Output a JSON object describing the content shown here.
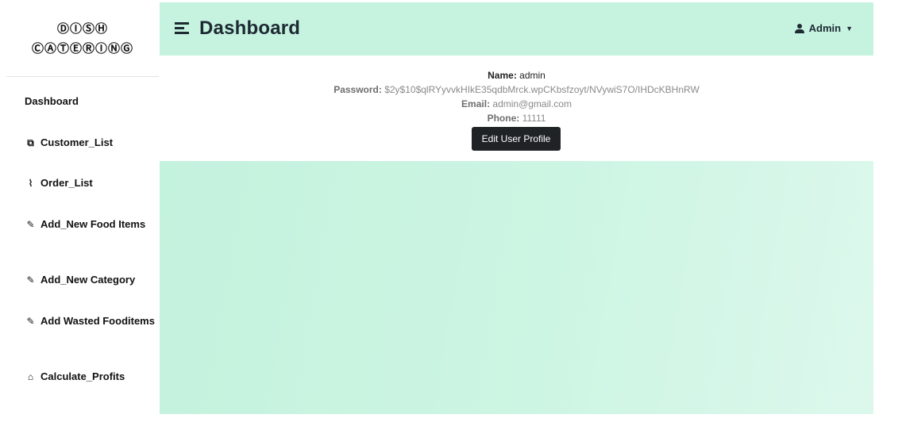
{
  "brand": {
    "line1": "ⒹⒾⓈⒽ",
    "line2": "ⒸⒶⓉⒺⓇⒾⓃⒼ"
  },
  "sidebar": {
    "items": [
      {
        "label": "Dashboard",
        "icon": "",
        "icon_name": ""
      },
      {
        "label": "Customer_List",
        "icon": "⧉",
        "icon_name": "sitemap-icon"
      },
      {
        "label": "Order_List",
        "icon": "⌇",
        "icon_name": "line-chart-icon"
      },
      {
        "label": "Add_New Food Items",
        "icon": "✎",
        "icon_name": "paperclip-icon"
      },
      {
        "label": "Add_New Category",
        "icon": "✎",
        "icon_name": "paperclip-icon"
      },
      {
        "label": "Add Wasted Fooditems",
        "icon": "✎",
        "icon_name": "paperclip-icon"
      },
      {
        "label": "Calculate_Profits",
        "icon": "⌂",
        "icon_name": "gift-icon"
      }
    ]
  },
  "header": {
    "title": "Dashboard",
    "user_label": "Admin",
    "caret": "▼",
    "background": "#c6f3df"
  },
  "profile": {
    "name_label": "Name:",
    "name_value": " admin",
    "password_label": "Password:",
    "password_value": " $2y$10$qlRYyvvkHIkE35qdbMrck.wpCKbsfzoyt/NVywiS7O/IHDcKBHnRW",
    "email_label": "Email:",
    "email_value": " admin@gmail.com",
    "phone_label": "Phone:",
    "phone_value": " 11111",
    "edit_button": "Edit User Profile"
  }
}
